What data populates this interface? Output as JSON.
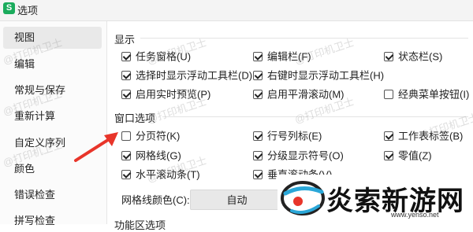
{
  "window": {
    "title": "选项",
    "app_icon_letter": "S"
  },
  "sidebar": {
    "items": [
      {
        "label": "视图",
        "active": true
      },
      {
        "label": "编辑"
      },
      {
        "label": "常规与保存"
      },
      {
        "label": "重新计算"
      },
      {
        "label": "自定义序列"
      },
      {
        "label": "颜色"
      },
      {
        "label": "错误检查"
      },
      {
        "label": "拼写检查"
      }
    ]
  },
  "display": {
    "title": "显示",
    "options": [
      {
        "label": "任务窗格(U)",
        "checked": true
      },
      {
        "label": "编辑栏(F)",
        "checked": true
      },
      {
        "label": "状态栏(S)",
        "checked": true
      },
      {
        "label": "选择时显示浮动工具栏(D)",
        "checked": true
      },
      {
        "label": "右键时显示浮动工具栏(H)",
        "checked": true
      },
      {
        "label": "启用实时预览(P)",
        "checked": true
      },
      {
        "label": "启用平滑滚动(M)",
        "checked": true
      },
      {
        "label": "经典菜单按钮(I)",
        "checked": false
      }
    ]
  },
  "window_options": {
    "title": "窗口选项",
    "options": [
      {
        "label": "分页符(K)",
        "checked": false
      },
      {
        "label": "行号列标(E)",
        "checked": true
      },
      {
        "label": "工作表标签(B)",
        "checked": true
      },
      {
        "label": "网格线(G)",
        "checked": true
      },
      {
        "label": "分级显示符号(O)",
        "checked": true
      },
      {
        "label": "零值(Z)",
        "checked": true
      },
      {
        "label": "水平滚动条(T)",
        "checked": true
      },
      {
        "label": "垂直滚动条(V)",
        "checked": true
      }
    ],
    "gridline_color_label": "网格线颜色(C):",
    "gridline_color_value": "自动"
  },
  "next_section_partial": "功能区选项",
  "watermark_text": "@打印机卫士",
  "logo": {
    "text": "炎索新游网",
    "url": "www.yenso.net"
  },
  "colors": {
    "arrow": "#e8352a",
    "app_icon": "#1aab5c",
    "active_nav": "#e9e9e9"
  }
}
